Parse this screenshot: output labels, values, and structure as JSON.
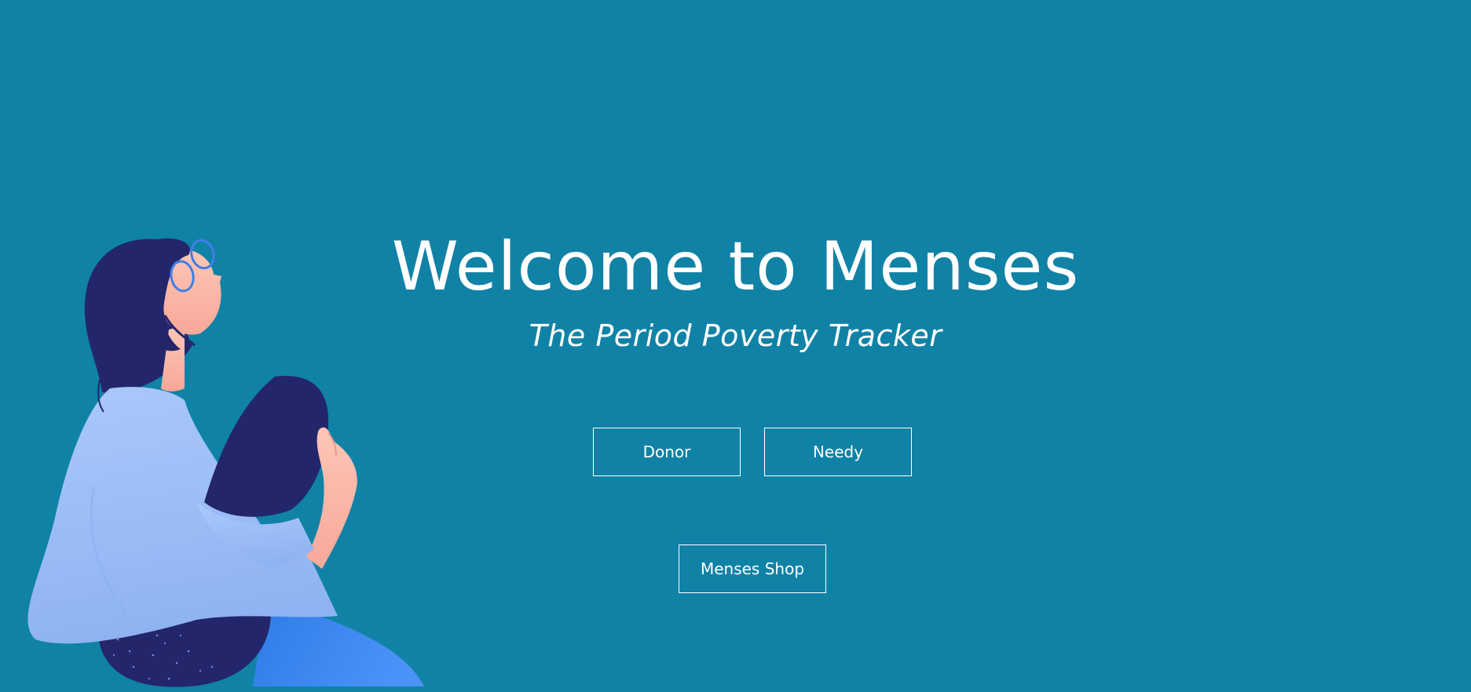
{
  "hero": {
    "title": "Welcome to Menses",
    "subtitle": "The Period Poverty Tracker"
  },
  "actions": {
    "donor_label": "Donor",
    "needy_label": "Needy",
    "shop_label": "Menses Shop"
  },
  "illustration": {
    "icon": "sitting-woman-illustration"
  },
  "colors": {
    "background": "#1082a6",
    "text": "#ffffff",
    "hair": "#23266b",
    "sweater": "#a2c3fa",
    "skin": "#fdbcac",
    "skirt": "#3d88f2",
    "glasses": "#3f7ee8"
  }
}
